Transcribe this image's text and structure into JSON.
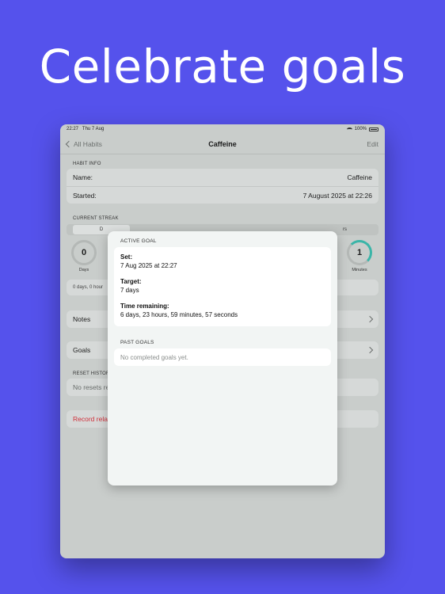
{
  "headline": "Celebrate goals",
  "status_bar": {
    "time": "22:27",
    "date": "Thu 7 Aug",
    "battery": "100%"
  },
  "nav": {
    "back_label": "All Habits",
    "title": "Caffeine",
    "edit_label": "Edit"
  },
  "habit_info": {
    "section_label": "HABIT INFO",
    "name_label": "Name:",
    "name_value": "Caffeine",
    "started_label": "Started:",
    "started_value": "7 August 2025 at 22:26"
  },
  "streak": {
    "section_label": "CURRENT STREAK",
    "segment_left": "D",
    "segment_right": "rs",
    "days_value": "0",
    "days_caption": "Days",
    "minutes_value": "1",
    "minutes_caption": "Minutes",
    "summary": "0 days, 0 hour"
  },
  "rows": {
    "notes": "Notes",
    "goals": "Goals"
  },
  "reset_history": {
    "section_label": "RESET HISTOR",
    "empty_text": "No resets re"
  },
  "record_relapse": "Record rela",
  "modal": {
    "active_label": "ACTIVE GOAL",
    "set_title": "Set:",
    "set_value": "7 Aug 2025 at 22:27",
    "target_title": "Target:",
    "target_value": "7 days",
    "remaining_title": "Time remaining:",
    "remaining_value": "6 days, 23 hours, 59 minutes, 57 seconds",
    "past_label": "PAST GOALS",
    "past_empty": "No completed goals yet."
  },
  "colors": {
    "background": "#5552ec",
    "accent_teal": "#3ab5a8",
    "destructive": "#d0313b"
  }
}
